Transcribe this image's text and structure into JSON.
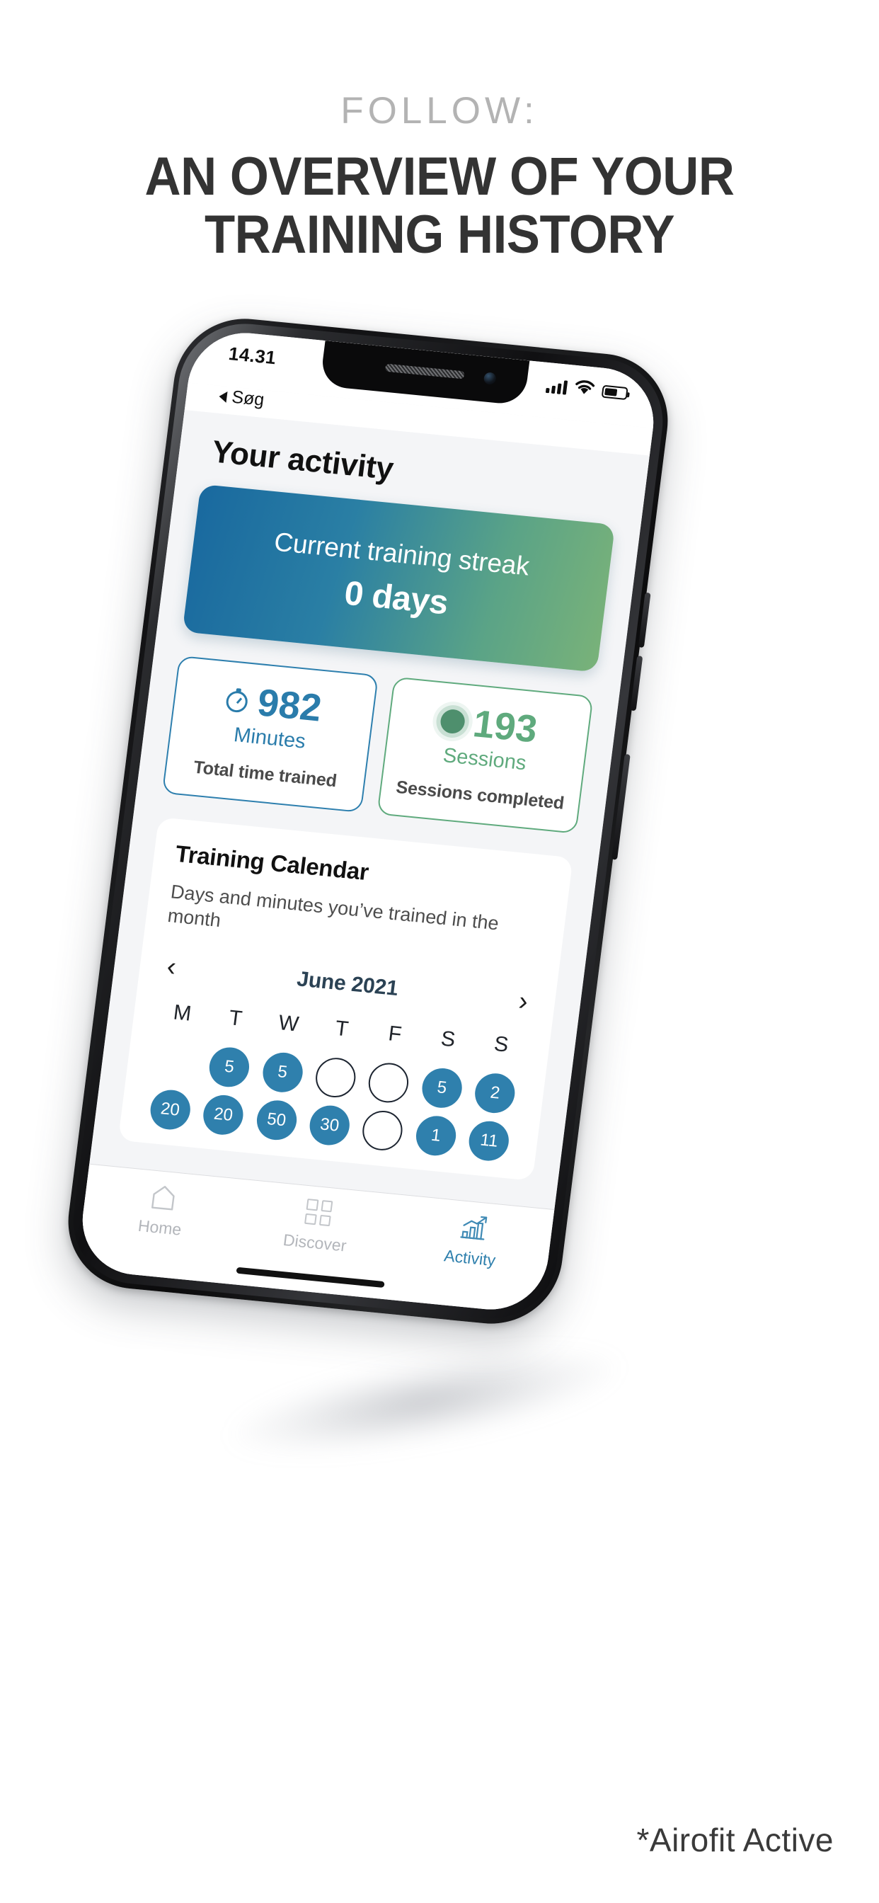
{
  "promo": {
    "eyebrow": "FOLLOW:",
    "title_line1": "AN OVERVIEW OF YOUR",
    "title_line2": "TRAINING HISTORY",
    "footer_caption": "*Airofit Active"
  },
  "status_bar": {
    "time": "14.31",
    "back_label": "Søg",
    "signal_icon": "signal-bars-icon",
    "wifi_icon": "wifi-icon",
    "battery_icon": "battery-icon",
    "battery_level_percent": 62
  },
  "app": {
    "page_title": "Your activity",
    "streak_card": {
      "label": "Current training streak",
      "value": "0 days",
      "gradient_from": "#19699f",
      "gradient_to": "#79b279"
    },
    "stats": [
      {
        "icon": "stopwatch-icon",
        "value": "982",
        "unit": "Minutes",
        "caption": "Total time trained",
        "accent": "#2a7cab"
      },
      {
        "icon": "session-dot-icon",
        "value": "193",
        "unit": "Sessions",
        "caption": "Sessions completed",
        "accent": "#5faa7d"
      }
    ],
    "calendar": {
      "title": "Training Calendar",
      "subtitle": "Days and minutes you’ve trained in the month",
      "prev_icon": "chevron-left-icon",
      "next_icon": "chevron-right-icon",
      "month": "June 2021",
      "day_initials": [
        "M",
        "T",
        "W",
        "T",
        "F",
        "S",
        "S"
      ],
      "cells": [
        {
          "state": "blank",
          "value": ""
        },
        {
          "state": "filled",
          "value": "5"
        },
        {
          "state": "filled",
          "value": "5"
        },
        {
          "state": "empty",
          "value": ""
        },
        {
          "state": "empty",
          "value": ""
        },
        {
          "state": "filled",
          "value": "5"
        },
        {
          "state": "filled",
          "value": "2"
        },
        {
          "state": "filled",
          "value": "20"
        },
        {
          "state": "filled",
          "value": "20"
        },
        {
          "state": "filled",
          "value": "50"
        },
        {
          "state": "filled",
          "value": "30"
        },
        {
          "state": "empty",
          "value": ""
        },
        {
          "state": "filled",
          "value": "1"
        },
        {
          "state": "filled",
          "value": "11"
        }
      ]
    },
    "tabs": [
      {
        "label": "Home",
        "icon": "home-icon",
        "active": false
      },
      {
        "label": "Discover",
        "icon": "grid-icon",
        "active": false
      },
      {
        "label": "Activity",
        "icon": "bar-chart-icon",
        "active": true
      }
    ]
  }
}
